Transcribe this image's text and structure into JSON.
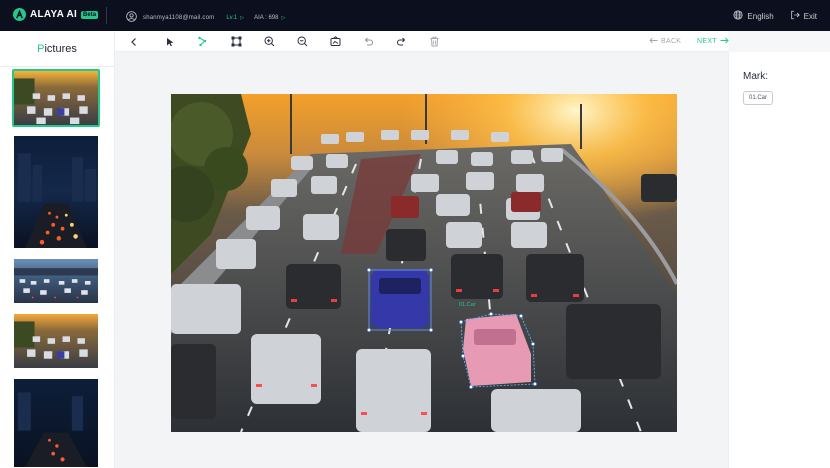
{
  "app": {
    "brand": "ALAYA AI",
    "brand_badge": "Beta",
    "user_email": "shanmya1108@mail.com",
    "level": "Lv.1",
    "aia_label": "AIA : 698",
    "language": "English",
    "exit": "Exit",
    "accent_color": "#22c98a",
    "topbar_color": "#0c0f1e"
  },
  "left_panel": {
    "title_prefix": "P",
    "title_rest": "ictures",
    "thumbnails": [
      {
        "name": "traffic-sunset-1",
        "selected": true
      },
      {
        "name": "traffic-night-1",
        "selected": false
      },
      {
        "name": "traffic-dusk",
        "selected": false
      },
      {
        "name": "traffic-sunset-2",
        "selected": false
      },
      {
        "name": "traffic-night-2",
        "selected": false
      }
    ]
  },
  "toolbar": {
    "tools": [
      "back-arrow-icon",
      "pointer-icon",
      "polygon-tool-icon",
      "bounding-box-icon",
      "zoom-in-icon",
      "zoom-out-icon",
      "fit-image-icon",
      "undo-icon",
      "redo-icon",
      "trash-icon"
    ],
    "back_label": "BACK",
    "next_label": "NEXT"
  },
  "canvas": {
    "annotation_label": "01.Car"
  },
  "right_panel": {
    "title": "Mark:",
    "tags": [
      "01.Car"
    ]
  }
}
